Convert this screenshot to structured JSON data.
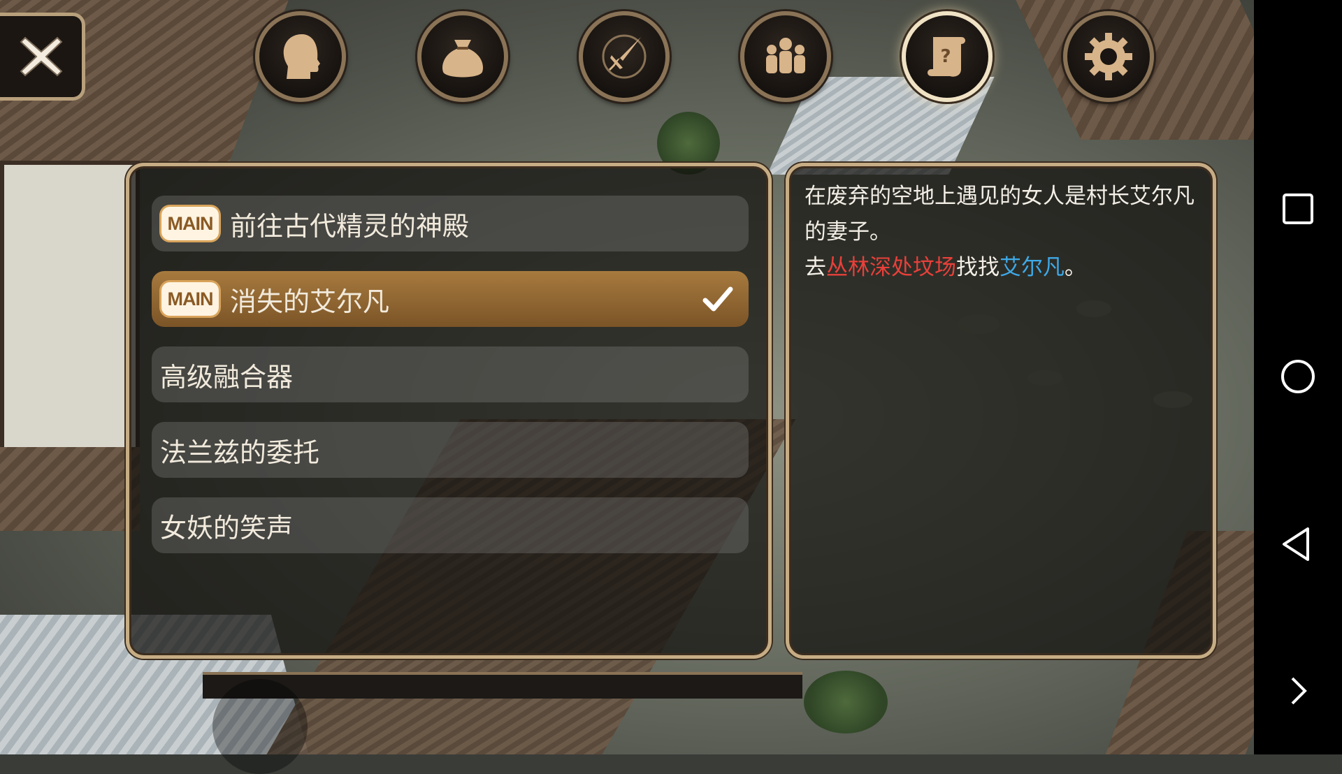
{
  "top_menu": {
    "close_icon": "close-x-icon",
    "tabs": [
      {
        "id": "character",
        "icon": "head-silhouette-icon",
        "active": false
      },
      {
        "id": "inventory",
        "icon": "bag-icon",
        "active": false
      },
      {
        "id": "skills",
        "icon": "sword-compass-icon",
        "active": false
      },
      {
        "id": "party",
        "icon": "group-people-icon",
        "active": false
      },
      {
        "id": "quests",
        "icon": "quest-scroll-icon",
        "active": true
      },
      {
        "id": "settings",
        "icon": "gear-icon",
        "active": false
      }
    ]
  },
  "quest_list": {
    "items": [
      {
        "badge": "MAIN",
        "label": "前往古代精灵的神殿",
        "selected": false
      },
      {
        "badge": "MAIN",
        "label": "消失的艾尔凡",
        "selected": true
      },
      {
        "badge": "",
        "label": "高级融合器",
        "selected": false
      },
      {
        "badge": "",
        "label": "法兰兹的委托",
        "selected": false
      },
      {
        "badge": "",
        "label": "女妖的笑声",
        "selected": false
      }
    ]
  },
  "quest_detail": {
    "line1": "在废弃的空地上遇见的女人是村长艾尔凡的妻子。",
    "line2_prefix": "去",
    "line2_location": "丛林深处坟场",
    "line2_middle": "找找",
    "line2_person": "艾尔凡",
    "line2_suffix": "。"
  },
  "navbar": {
    "icons": [
      "recent-apps-square-icon",
      "home-circle-icon",
      "back-triangle-icon",
      "expand-chevron-icon"
    ]
  },
  "colors": {
    "panel_border": "#c7ad85",
    "selected_row": "#8f6531",
    "location_text": "#e8403a",
    "person_text": "#3ea9e6"
  }
}
